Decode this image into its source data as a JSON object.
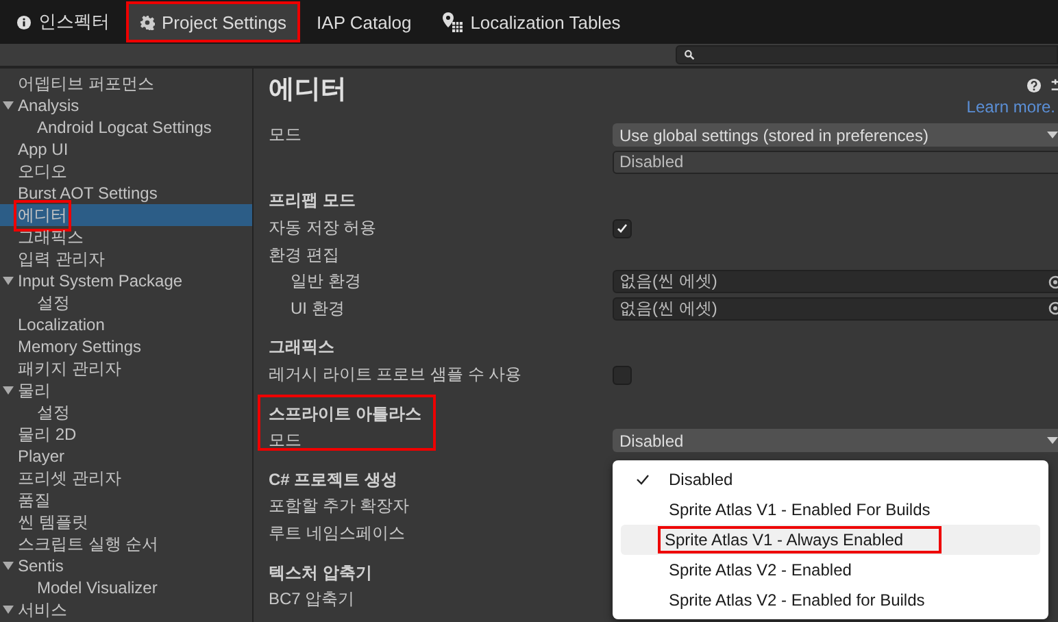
{
  "tabs": [
    {
      "label": "인스펙터",
      "selected": false,
      "highlighted": false
    },
    {
      "label": "Project Settings",
      "selected": true,
      "highlighted": true
    },
    {
      "label": "IAP Catalog",
      "selected": false,
      "highlighted": false
    },
    {
      "label": "Localization Tables",
      "selected": false,
      "highlighted": false
    }
  ],
  "sidebar": {
    "items": [
      {
        "label": "어뎁티브 퍼포먼스",
        "selected": false,
        "highlighted": false
      },
      {
        "label": "Analysis",
        "selected": false,
        "highlighted": false,
        "expanded": true,
        "children": [
          {
            "label": "Android Logcat Settings",
            "selected": false,
            "highlighted": false
          }
        ]
      },
      {
        "label": "App UI",
        "selected": false,
        "highlighted": false
      },
      {
        "label": "오디오",
        "selected": false,
        "highlighted": false
      },
      {
        "label": "Burst AOT Settings",
        "selected": false,
        "highlighted": false
      },
      {
        "label": "에디터",
        "selected": true,
        "highlighted": true
      },
      {
        "label": "그래픽스",
        "selected": false,
        "highlighted": false
      },
      {
        "label": "입력 관리자",
        "selected": false,
        "highlighted": false
      },
      {
        "label": "Input System Package",
        "selected": false,
        "highlighted": false,
        "expanded": true,
        "children": [
          {
            "label": "설정",
            "selected": false,
            "highlighted": false
          }
        ]
      },
      {
        "label": "Localization",
        "selected": false,
        "highlighted": false
      },
      {
        "label": "Memory Settings",
        "selected": false,
        "highlighted": false
      },
      {
        "label": "패키지 관리자",
        "selected": false,
        "highlighted": false
      },
      {
        "label": "물리",
        "selected": false,
        "highlighted": false,
        "expanded": true,
        "children": [
          {
            "label": "설정",
            "selected": false,
            "highlighted": false
          }
        ]
      },
      {
        "label": "물리 2D",
        "selected": false,
        "highlighted": false
      },
      {
        "label": "Player",
        "selected": false,
        "highlighted": false
      },
      {
        "label": "프리셋 관리자",
        "selected": false,
        "highlighted": false
      },
      {
        "label": "품질",
        "selected": false,
        "highlighted": false
      },
      {
        "label": "씬 템플릿",
        "selected": false,
        "highlighted": false
      },
      {
        "label": "스크립트 실행 순서",
        "selected": false,
        "highlighted": false
      },
      {
        "label": "Sentis",
        "selected": false,
        "highlighted": false,
        "expanded": true,
        "children": [
          {
            "label": "Model Visualizer",
            "selected": false,
            "highlighted": false
          }
        ]
      },
      {
        "label": "서비스",
        "selected": false,
        "highlighted": false,
        "expanded": true
      }
    ]
  },
  "editor": {
    "title": "에디터",
    "learn_more": "Learn more.",
    "groups": [
      {
        "highlighted": false,
        "rows": [
          {
            "kind": "dropdown",
            "label": "모드",
            "value": "Use global settings (stored in preferences)"
          },
          {
            "kind": "field",
            "value": "Disabled"
          }
        ]
      },
      {
        "heading": "프리팹 모드",
        "highlighted": false,
        "rows": [
          {
            "kind": "checkbox",
            "label": "자동 저장 허용",
            "checked": true
          },
          {
            "kind": "label",
            "label": "환경 편집",
            "children": [
              {
                "kind": "object",
                "label": "일반 환경",
                "value": "없음(씬 에셋)"
              },
              {
                "kind": "object",
                "label": "UI 환경",
                "value": "없음(씬 에셋)"
              }
            ]
          }
        ]
      },
      {
        "heading": "그래픽스",
        "highlighted": false,
        "rows": [
          {
            "kind": "checkbox",
            "label": "레거시 라이트 프로브 샘플 수 사용",
            "checked": false
          }
        ]
      },
      {
        "heading": "스프라이트 아틀라스",
        "highlighted": true,
        "rows": [
          {
            "kind": "dropdown",
            "label": "모드",
            "value": "Disabled"
          }
        ]
      },
      {
        "heading": "C# 프로젝트 생성",
        "highlighted": false,
        "rows": [
          {
            "kind": "label",
            "label": "포함할 추가 확장자"
          },
          {
            "kind": "label",
            "label": "루트 네임스페이스"
          }
        ]
      },
      {
        "heading": "텍스처 압축기",
        "highlighted": false,
        "rows": [
          {
            "kind": "label",
            "label": "BC7 압축기"
          }
        ]
      }
    ]
  },
  "popup": {
    "options": [
      {
        "label": "Disabled",
        "selected": true,
        "hovered": false,
        "highlighted": false
      },
      {
        "label": "Sprite Atlas V1 - Enabled For Builds",
        "selected": false,
        "hovered": false,
        "highlighted": false
      },
      {
        "label": "Sprite Atlas V1 - Always Enabled",
        "selected": false,
        "hovered": true,
        "highlighted": true
      },
      {
        "label": "Sprite Atlas V2 - Enabled",
        "selected": false,
        "hovered": false,
        "highlighted": false
      },
      {
        "label": "Sprite Atlas V2 - Enabled for Builds",
        "selected": false,
        "hovered": false,
        "highlighted": false
      }
    ]
  }
}
